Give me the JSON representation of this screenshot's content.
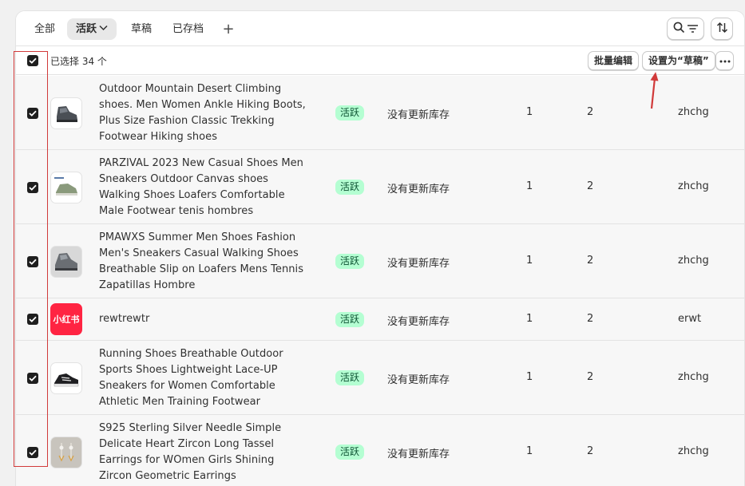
{
  "tabs": [
    {
      "label": "全部",
      "active": false
    },
    {
      "label": "活跃",
      "active": true
    },
    {
      "label": "草稿",
      "active": false
    },
    {
      "label": "已存档",
      "active": false
    }
  ],
  "add_tab_glyph": "+",
  "toolbar": {
    "search_filter_icon": "search-filter-icon",
    "sort_icon": "sort-icon"
  },
  "bulk": {
    "selected_text": "已选择 34 个",
    "bulk_edit_label": "批量编辑",
    "set_draft_label": "设置为“草稿”",
    "more_icon": "more-horizontal-icon"
  },
  "products": [
    {
      "title_lines": [
        "Outdoor Mountain Desert Climbing",
        "shoes. Men Women Ankle Hiking Boots,",
        "Plus Size Fashion Classic Trekking",
        "Footwear Hiking shoes"
      ],
      "status": "活跃",
      "inventory": "没有更新库存",
      "col1": "1",
      "col2": "2",
      "vendor": "zhchg",
      "thumb": "hiking-boot-image"
    },
    {
      "title_lines": [
        "PARZIVAL 2023 New Casual Shoes Men",
        "Sneakers Outdoor Canvas shoes",
        "Walking Shoes Loafers Comfortable",
        "Male Footwear tenis hombres"
      ],
      "status": "活跃",
      "inventory": "没有更新库存",
      "col1": "1",
      "col2": "2",
      "vendor": "zhchg",
      "thumb": "canvas-shoe-image"
    },
    {
      "title_lines": [
        "PMAWXS Summer Men Shoes Fashion",
        "Men's Sneakers Casual Walking Shoes",
        "Breathable Slip on Loafers Mens Tennis",
        "Zapatillas Hombre"
      ],
      "status": "活跃",
      "inventory": "没有更新库存",
      "col1": "1",
      "col2": "2",
      "vendor": "zhchg",
      "thumb": "sneaker-image"
    },
    {
      "title_lines": [
        "rewtrewtr"
      ],
      "status": "活跃",
      "inventory": "没有更新库存",
      "col1": "1",
      "col2": "2",
      "vendor": "erwt",
      "thumb": "xiaohongshu-logo",
      "thumb_text": "小红书"
    },
    {
      "title_lines": [
        "Running Shoes Breathable Outdoor",
        "Sports Shoes Lightweight Lace-UP",
        "Sneakers for Women Comfortable",
        "Athletic Men Training Footwear"
      ],
      "status": "活跃",
      "inventory": "没有更新库存",
      "col1": "1",
      "col2": "2",
      "vendor": "zhchg",
      "thumb": "running-shoe-image"
    },
    {
      "title_lines": [
        "S925 Sterling Silver Needle Simple",
        "Delicate Heart Zircon Long Tassel",
        "Earrings for WOmen Girls Shining",
        "Zircon Geometric Earrings"
      ],
      "status": "活跃",
      "inventory": "没有更新库存",
      "col1": "1",
      "col2": "2",
      "vendor": "zhchg",
      "thumb": "earrings-image"
    }
  ],
  "colors": {
    "badge_bg": "#b4fed2",
    "badge_text": "#0c5132",
    "checkbox": "#1f1f1f",
    "annotation": "#d13a3a",
    "xiaohongshu": "#ff2442"
  }
}
